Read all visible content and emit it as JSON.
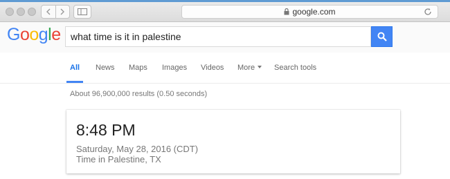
{
  "browser": {
    "url": "google.com"
  },
  "google": {
    "logo": [
      "G",
      "o",
      "o",
      "g",
      "l",
      "e"
    ],
    "logo_colors": [
      "#4285f4",
      "#ea4335",
      "#fbbc05",
      "#4285f4",
      "#34a853",
      "#ea4335"
    ],
    "query": "what time is it in palestine"
  },
  "tabs": [
    {
      "label": "All"
    },
    {
      "label": "News"
    },
    {
      "label": "Maps"
    },
    {
      "label": "Images"
    },
    {
      "label": "Videos"
    },
    {
      "label": "More"
    },
    {
      "label": "Search tools"
    }
  ],
  "stats": "About 96,900,000 results (0.50 seconds)",
  "result": {
    "time": "8:48 PM",
    "date": "Saturday, May 28, 2016 (CDT)",
    "location": "Time in Palestine, TX"
  },
  "colors": {
    "accent": "#4285f4",
    "active_tab": "#1a73e8"
  }
}
